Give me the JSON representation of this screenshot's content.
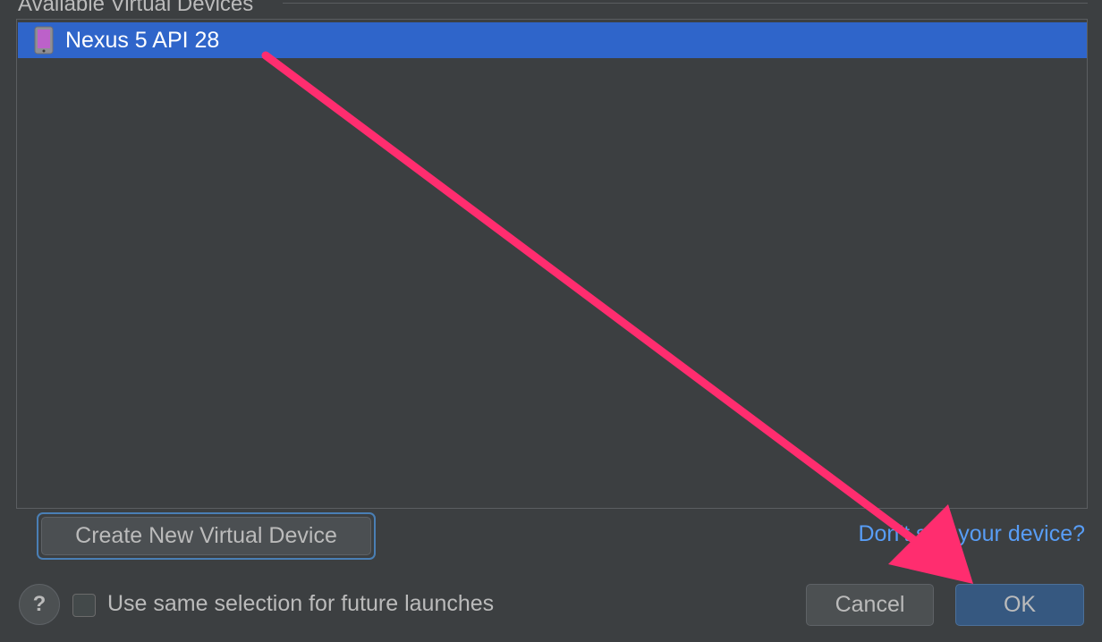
{
  "dialog": {
    "section_title": "Available Virtual Devices"
  },
  "devices": {
    "items": [
      {
        "name": "Nexus 5 API 28",
        "selected": true,
        "icon": "phone-icon"
      }
    ]
  },
  "actions": {
    "create_label": "Create New Virtual Device",
    "help_link": "Don't see your device?",
    "help_icon": "?",
    "future_launches_label": "Use same selection for future launches",
    "future_launches_checked": false,
    "cancel_label": "Cancel",
    "ok_label": "OK"
  },
  "colors": {
    "background": "#3c3f41",
    "selection": "#2f65ca",
    "link": "#589df6",
    "default_button": "#365880",
    "annotation_arrow": "#ff2d6f"
  }
}
